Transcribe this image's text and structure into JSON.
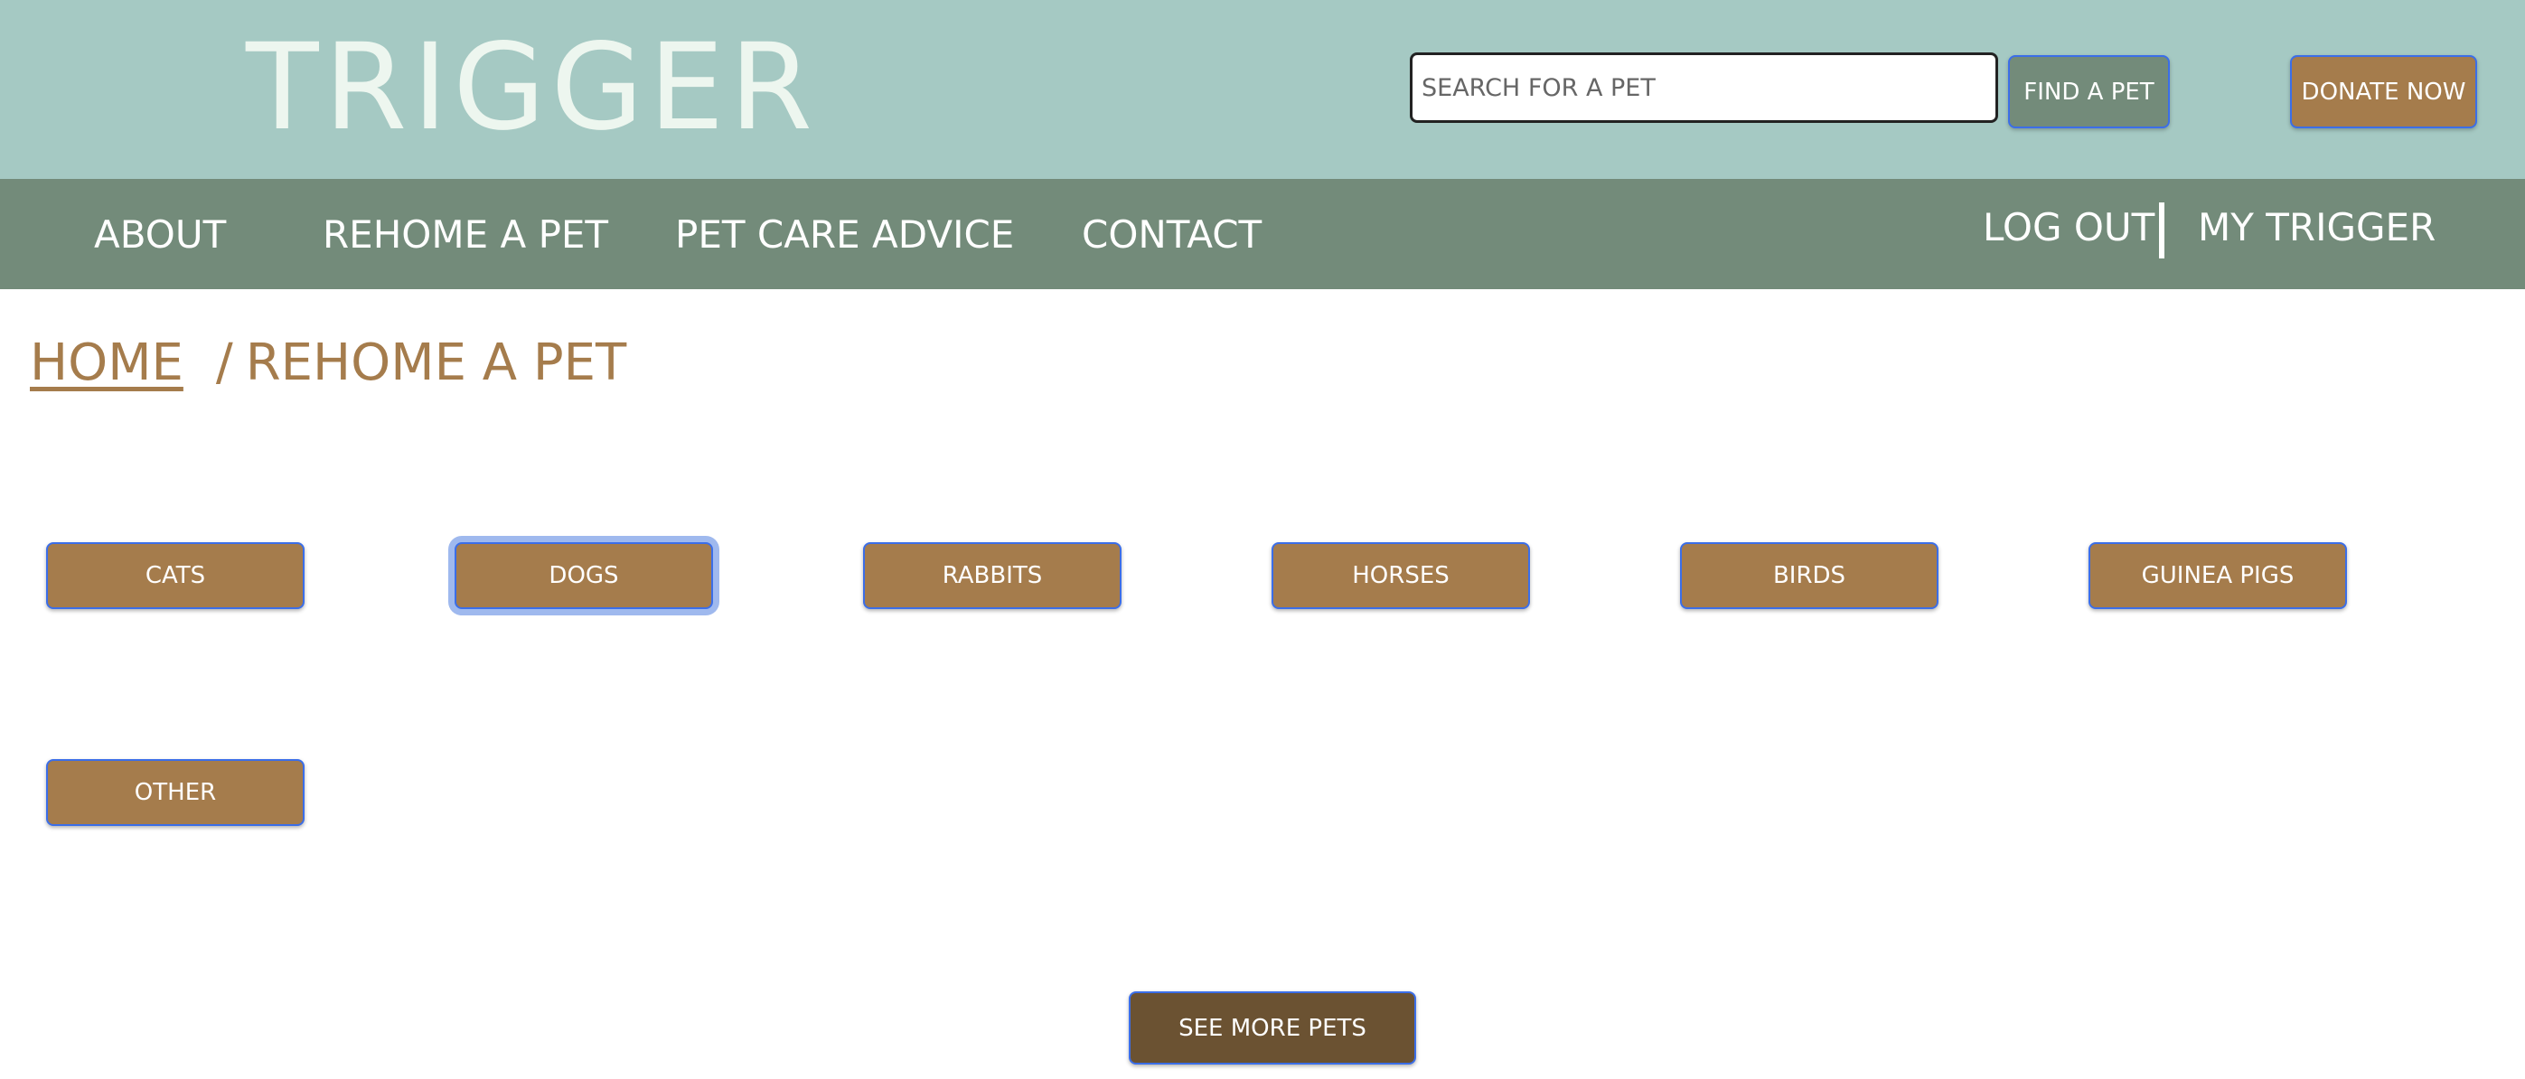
{
  "header": {
    "logo_text": "TRIGGER",
    "search_placeholder": "SEARCH FOR A PET",
    "find_pet_label": "FIND A PET",
    "donate_label": "DONATE NOW"
  },
  "nav": {
    "items": [
      "ABOUT",
      "REHOME A PET",
      "PET CARE ADVICE",
      "CONTACT"
    ],
    "logout_label": "LOG OUT",
    "my_trigger_label": "MY TRIGGER"
  },
  "breadcrumb": {
    "home": "HOME",
    "separator": "/",
    "current": "REHOME A PET"
  },
  "categories": [
    "CATS",
    "DOGS",
    "RABBITS",
    "HORSES",
    "BIRDS",
    "GUINEA PIGS",
    "OTHER"
  ],
  "focused_category": "DOGS",
  "see_more_label": "SEE MORE PETS",
  "colors": {
    "header_bg": "#a5c9c3",
    "nav_bg": "#738b7a",
    "accent_brown": "#a57c4c",
    "dark_brown": "#6b5232",
    "button_border": "#3b6ee8"
  }
}
